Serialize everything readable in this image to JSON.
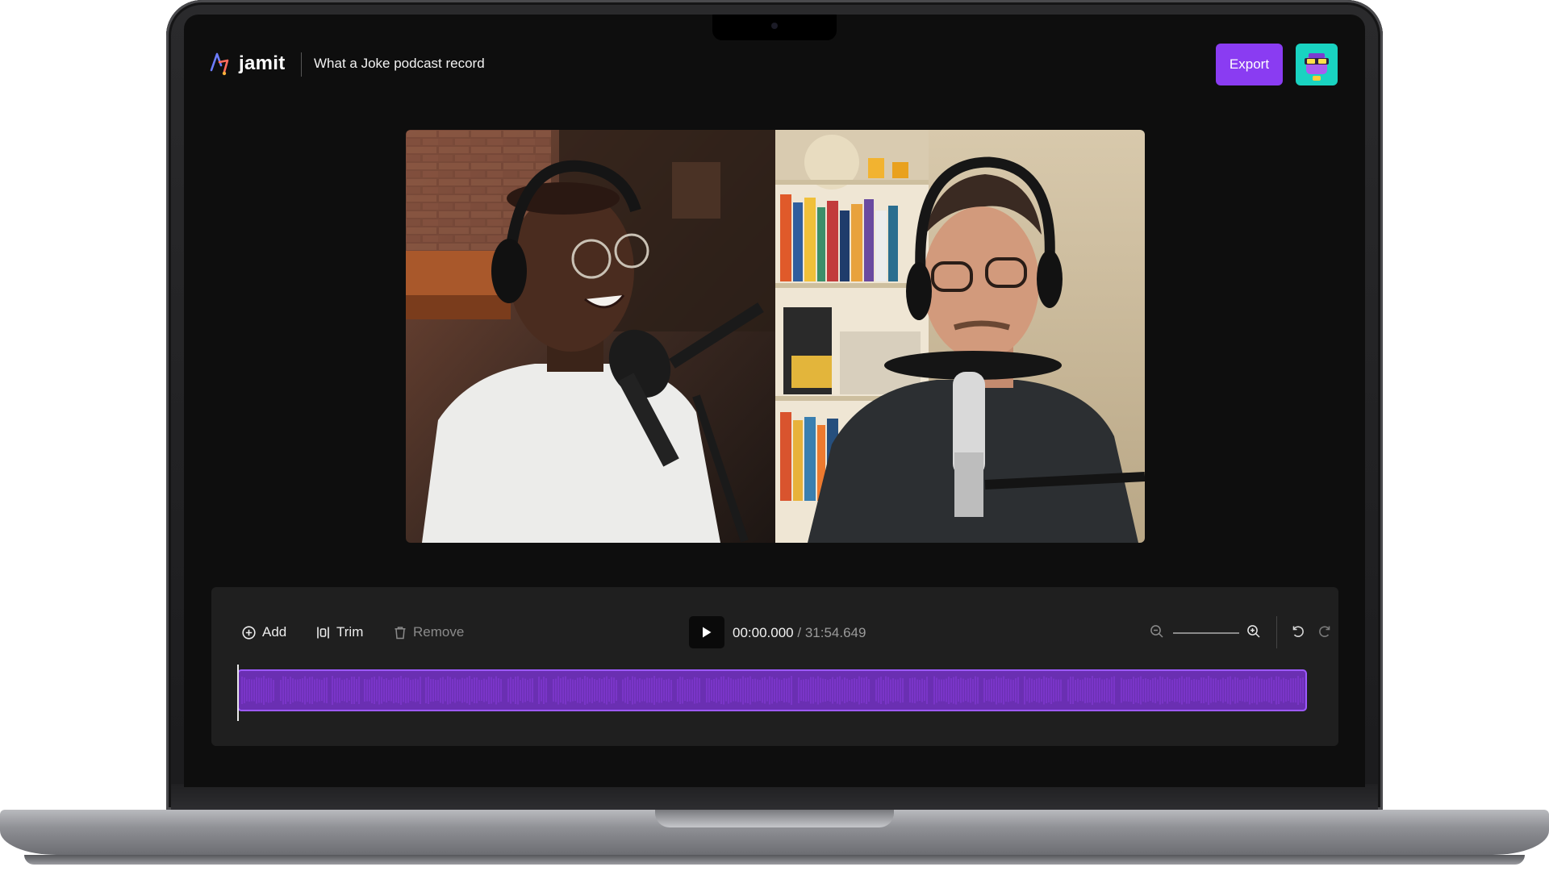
{
  "app": {
    "brand": "jamit",
    "project_title": "What a Joke podcast record",
    "export_label": "Export"
  },
  "toolbar": {
    "add_label": "Add",
    "trim_label": "Trim",
    "remove_label": "Remove",
    "current_time": "00:00.000",
    "separator": " / ",
    "total_time": "31:54.649"
  },
  "icons": {
    "add": "plus-circle-icon",
    "trim": "trim-icon",
    "remove": "trash-icon",
    "play": "play-icon",
    "zoom_out": "zoom-out-icon",
    "zoom_in": "zoom-in-icon",
    "undo": "undo-icon",
    "redo": "redo-icon"
  },
  "timeline": {
    "playhead_position": 0,
    "segments": 19
  },
  "colors": {
    "accent": "#8a3cf2",
    "track_fill": "#6a2fb2",
    "track_border": "#9d59ff",
    "avatar_bg": "#19d3c1"
  }
}
